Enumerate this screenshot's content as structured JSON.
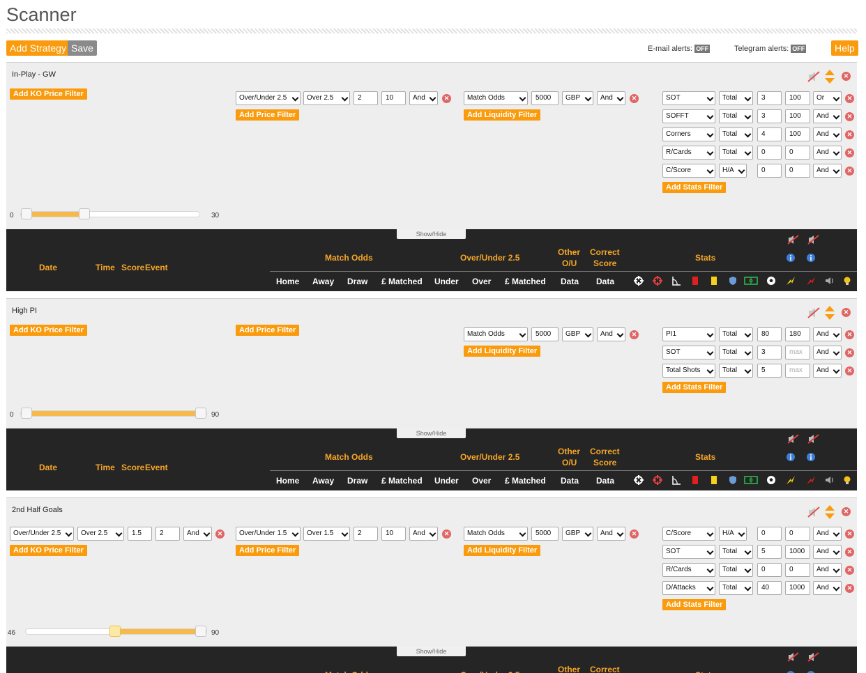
{
  "page": {
    "title": "Scanner"
  },
  "toolbar": {
    "add_strategy": "Add Strategy",
    "save": "Save",
    "help": "Help"
  },
  "alerts": {
    "email_label": "E-mail alerts:",
    "email_state": "OFF",
    "telegram_label": "Telegram alerts:",
    "telegram_state": "OFF"
  },
  "labels": {
    "add_ko_price_filter": "Add KO Price Filter",
    "add_price_filter": "Add Price Filter",
    "add_liquidity_filter": "Add Liquidity Filter",
    "add_stats_filter": "Add Stats Filter",
    "show_hide": "Show/Hide"
  },
  "table_header": {
    "date": "Date",
    "time": "Time",
    "score": "Score",
    "event": "Event",
    "match_odds": "Match Odds",
    "over_under": "Over/Under 2.5",
    "other_ou_1": "Other",
    "other_ou_2": "O/U",
    "correct_score_1": "Correct",
    "correct_score_2": "Score",
    "stats": "Stats",
    "home": "Home",
    "away": "Away",
    "draw": "Draw",
    "matched": "£ Matched",
    "under": "Under",
    "over": "Over",
    "matched2": "£ Matched",
    "data1": "Data",
    "data2": "Data"
  },
  "strategies": [
    {
      "name": "In-Play - GW",
      "price_filter": {
        "market": "Over/Under 2.5",
        "selection": "Over 2.5",
        "min": "2",
        "max": "10",
        "logic": "And"
      },
      "liquidity": {
        "market": "Match Odds",
        "amount": "5000",
        "currency": "GBP",
        "logic": "And"
      },
      "stats": [
        {
          "stat": "SOT",
          "scope": "Total",
          "min": "3",
          "max": "100",
          "logic": "Or"
        },
        {
          "stat": "SOFFT",
          "scope": "Total",
          "min": "3",
          "max": "100",
          "logic": "And"
        },
        {
          "stat": "Corners",
          "scope": "Total",
          "min": "4",
          "max": "100",
          "logic": "And"
        },
        {
          "stat": "R/Cards",
          "scope": "Total",
          "min": "0",
          "max": "0",
          "logic": "And"
        },
        {
          "stat": "C/Score",
          "scope": "H/A",
          "min": "0",
          "max": "0",
          "logic": "And"
        }
      ],
      "slider": {
        "min_label": "0",
        "max_label": "30",
        "low": 0,
        "high": 7
      }
    },
    {
      "name": "High PI",
      "liquidity": {
        "market": "Match Odds",
        "amount": "5000",
        "currency": "GBP",
        "logic": "And"
      },
      "stats": [
        {
          "stat": "PI1",
          "scope": "Total",
          "min": "80",
          "max": "180",
          "logic": "And"
        },
        {
          "stat": "SOT",
          "scope": "Total",
          "min": "3",
          "max": "max",
          "logic": "And"
        },
        {
          "stat": "Total Shots",
          "scope": "Total",
          "min": "5",
          "max": "max",
          "logic": "And"
        }
      ],
      "slider": {
        "min_label": "0",
        "max_label": "90",
        "low": 0,
        "high": 90
      }
    },
    {
      "name": "2nd Half Goals",
      "ko_filter": {
        "market": "Over/Under 2.5",
        "selection": "Over 2.5",
        "min": "1.5",
        "max": "2",
        "logic": "And"
      },
      "price_filter": {
        "market": "Over/Under 1.5",
        "selection": "Over 1.5",
        "min": "2",
        "max": "10",
        "logic": "And"
      },
      "liquidity": {
        "market": "Match Odds",
        "amount": "5000",
        "currency": "GBP",
        "logic": "And"
      },
      "stats": [
        {
          "stat": "C/Score",
          "scope": "H/A",
          "min": "0",
          "max": "0",
          "logic": "And"
        },
        {
          "stat": "SOT",
          "scope": "Total",
          "min": "5",
          "max": "1000",
          "logic": "And"
        },
        {
          "stat": "R/Cards",
          "scope": "Total",
          "min": "0",
          "max": "0",
          "logic": "And"
        },
        {
          "stat": "D/Attacks",
          "scope": "Total",
          "min": "40",
          "max": "1000",
          "logic": "And"
        }
      ],
      "slider": {
        "min_label": "46",
        "max_label": "90",
        "low": 46,
        "high": 90
      }
    }
  ],
  "colors": {
    "accent": "#f99b0c",
    "header_text": "#f7a627",
    "dark_bg": "#252525",
    "panel_bg": "#eeeeee",
    "remove": "#e06565"
  }
}
